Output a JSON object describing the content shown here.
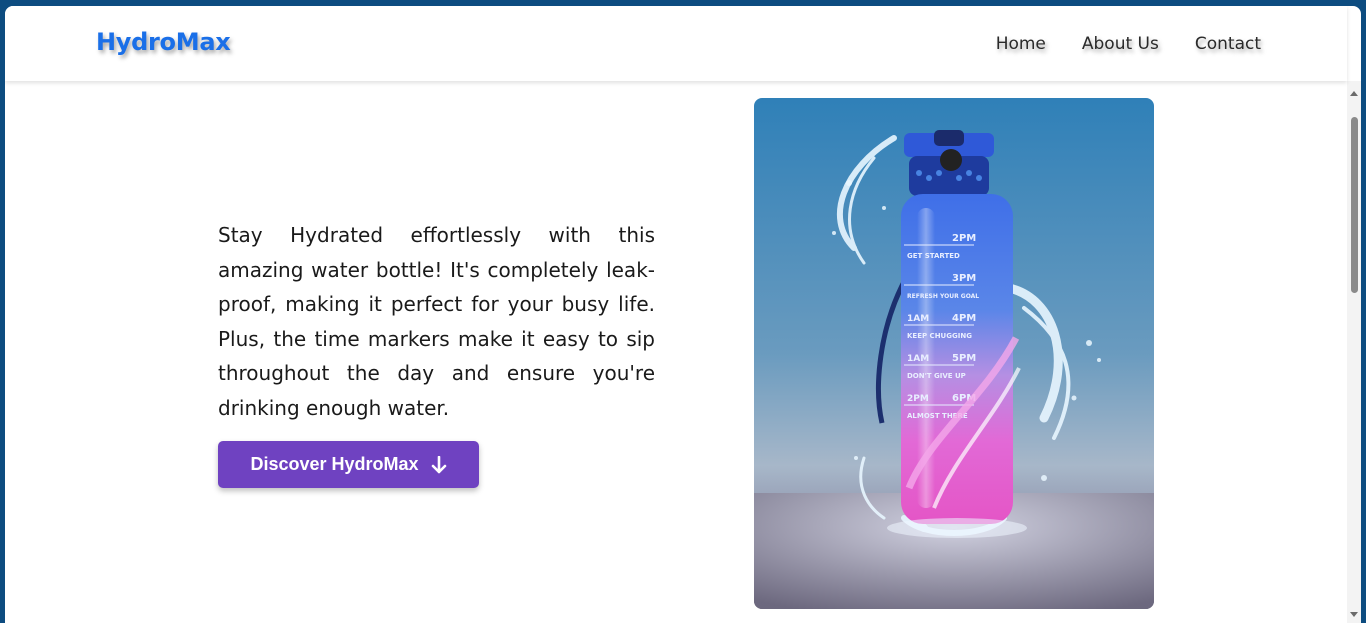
{
  "brand": {
    "name": "HydroMax",
    "color": "#1a6fe8"
  },
  "nav": {
    "links": [
      "Home",
      "About Us",
      "Contact"
    ]
  },
  "hero": {
    "description": "Stay Hydrated effortlessly with this amazing water bottle! It's completely leak-proof, making it perfect for your busy life. Plus, the time markers make it easy to sip throughout the day and ensure you're drinking enough water.",
    "cta_label": "Discover HydroMax",
    "cta_icon": "arrow-down-icon",
    "cta_color": "#6f42c1"
  },
  "product_image": {
    "subject": "water-bottle-splash-image",
    "markers": [
      {
        "left": "",
        "right": "2PM",
        "note": "GET STARTED"
      },
      {
        "left": "",
        "right": "3PM",
        "note": "REFRESH YOUR GOAL"
      },
      {
        "left": "1AM",
        "right": "4PM",
        "note": "KEEP CHUGGING"
      },
      {
        "left": "1AM",
        "right": "5PM",
        "note": "DON'T GIVE UP"
      },
      {
        "left": "2PM",
        "right": "6PM",
        "note": "ALMOST THERE"
      }
    ]
  }
}
